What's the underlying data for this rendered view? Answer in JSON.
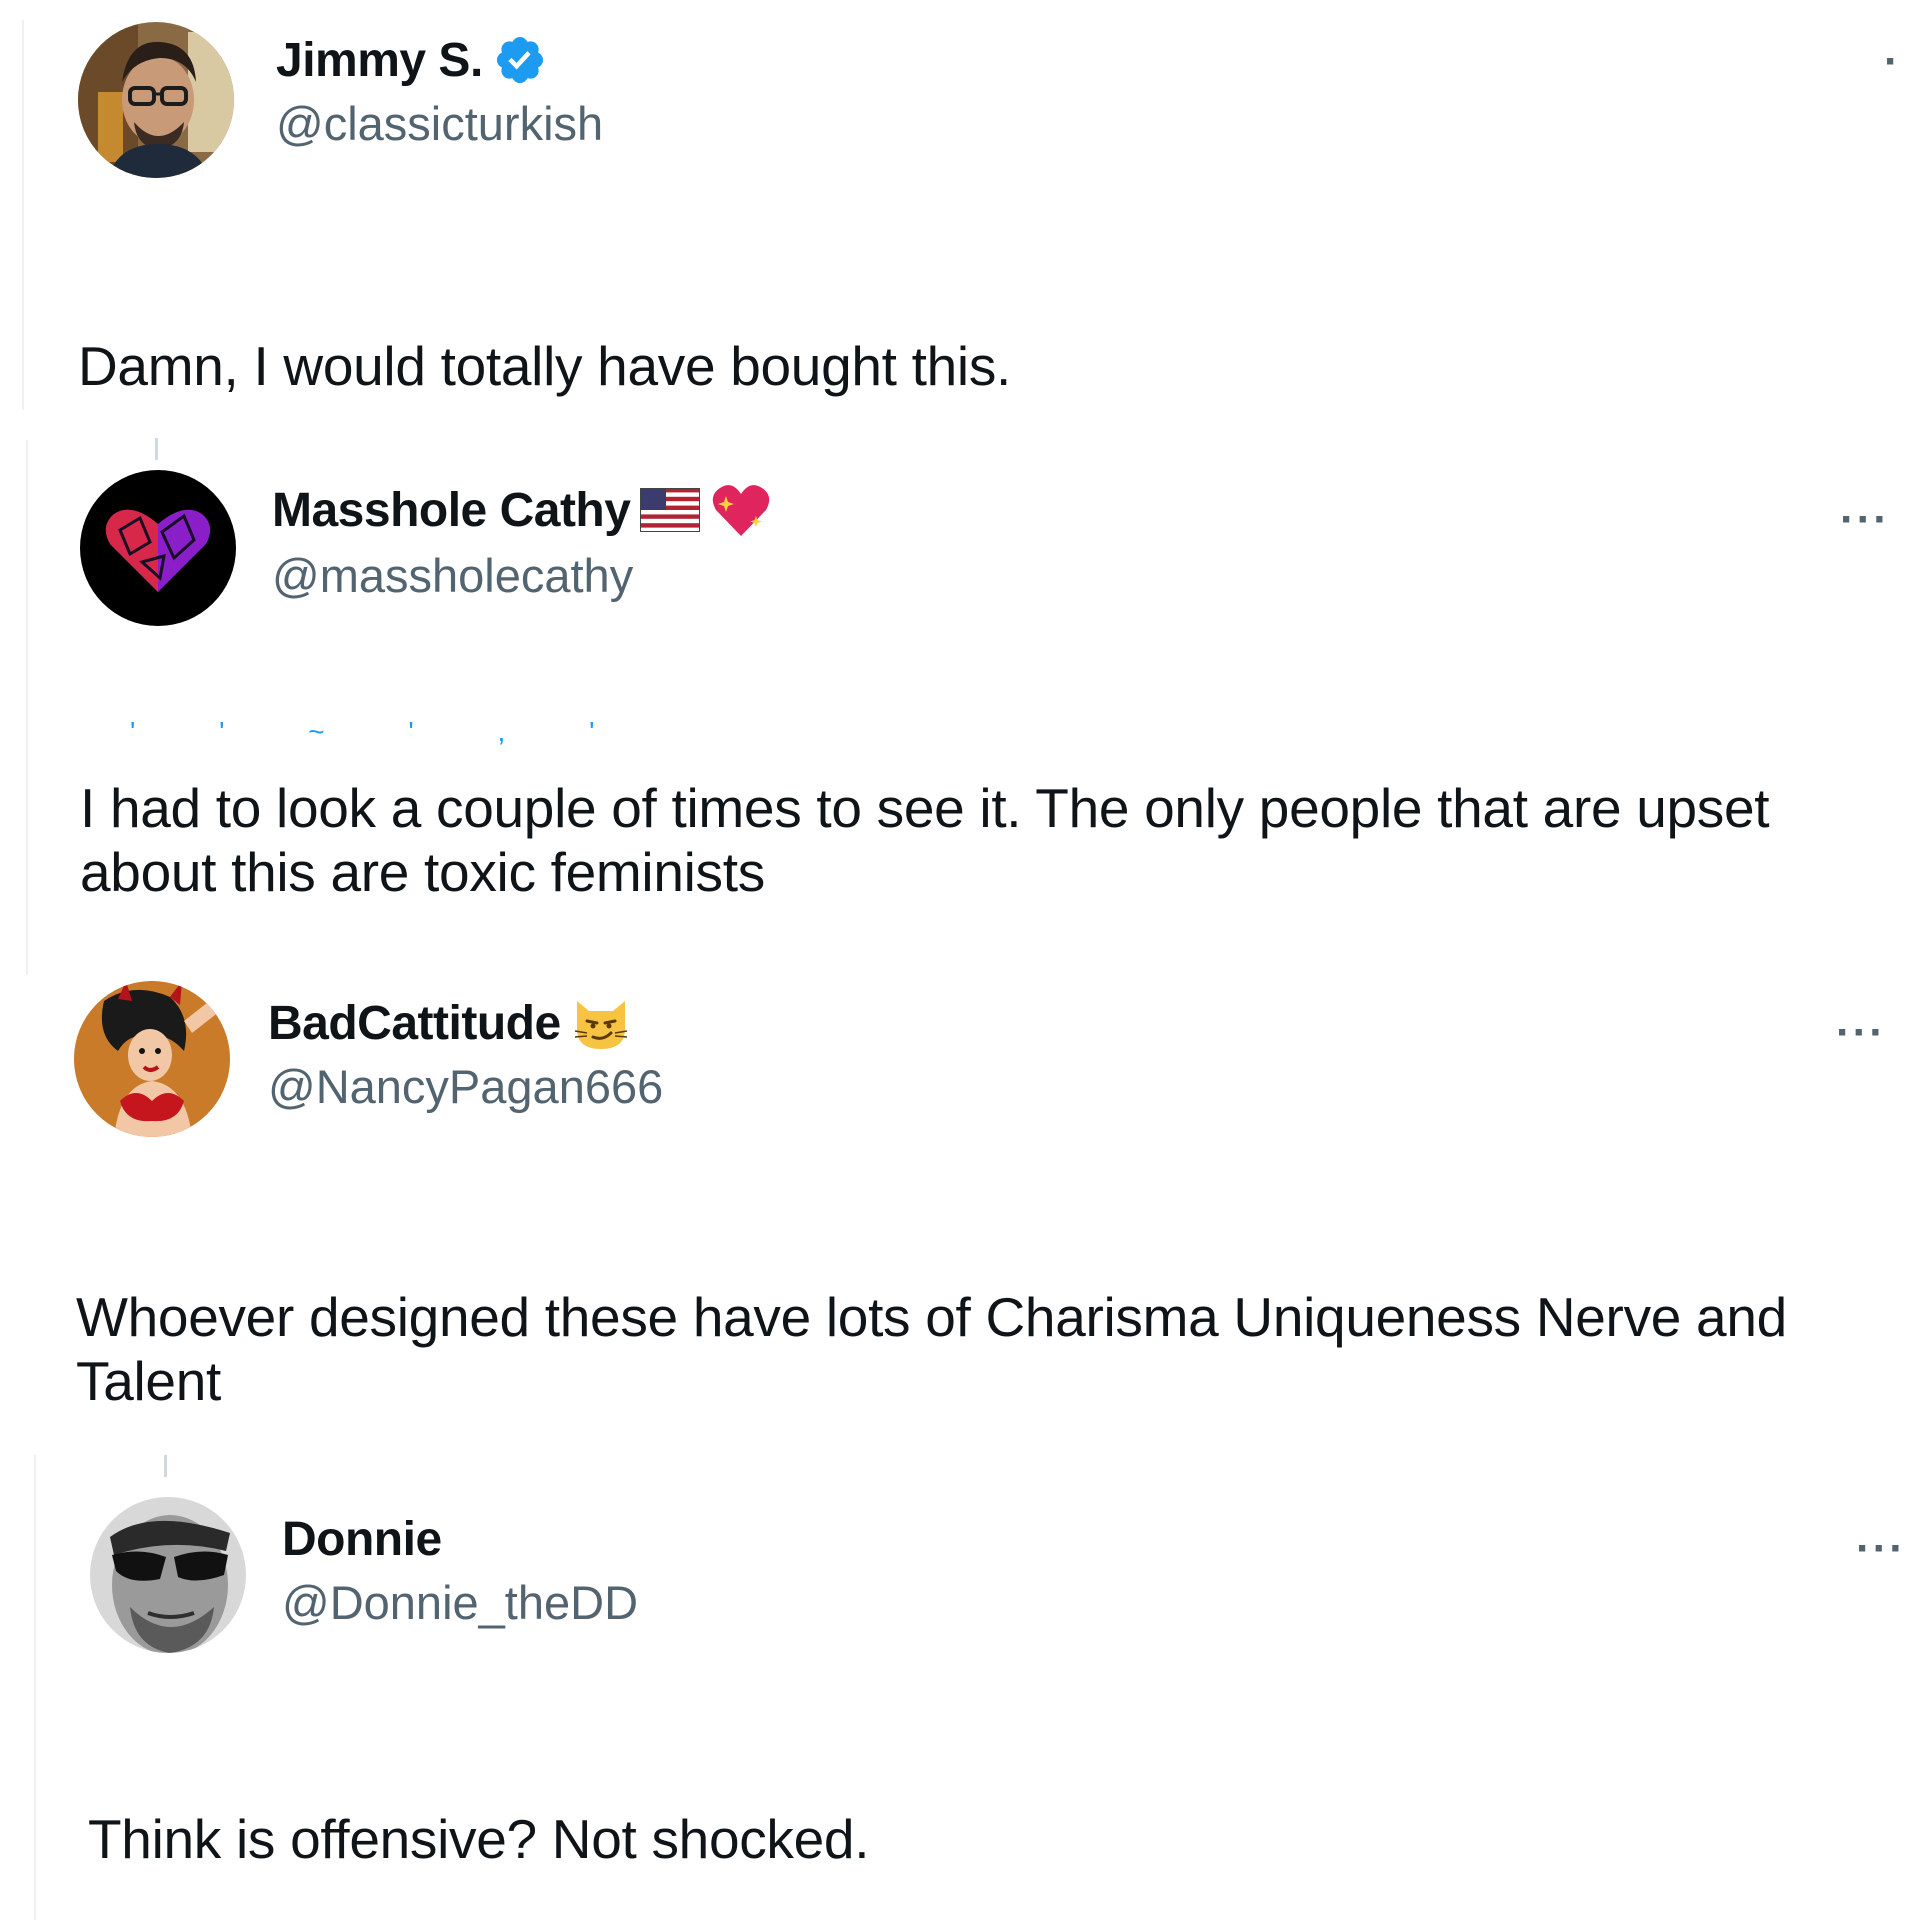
{
  "tweets": [
    {
      "display_name": "Jimmy S.",
      "handle": "@classicturkish",
      "verified": true,
      "text": "Damn, I would totally have bought this.",
      "avatar_icon": "profile-photo-man-glasses",
      "more_label": "·"
    },
    {
      "display_name": "Masshole Cathy",
      "name_emojis": [
        "us-flag-icon",
        "sparkling-heart-icon"
      ],
      "handle": "@massholecathy",
      "text": "I had to look a couple of times to see it. The only people that are upset about this are toxic feminists",
      "avatar_icon": "purple-heart-avatar",
      "more_label": "···"
    },
    {
      "display_name": "BadCattitude",
      "name_emojis": [
        "smirking-cat-icon"
      ],
      "handle": "@NancyPagan666",
      "text": "Whoever designed these have lots of Charisma Uniqueness Nerve and Talent",
      "avatar_icon": "pinup-devil-avatar",
      "more_label": "···"
    },
    {
      "display_name": "Donnie",
      "handle": "@Donnie_theDD",
      "text": "Think is offensive? Not shocked.",
      "avatar_icon": "man-sunglasses-avatar",
      "more_label": "···"
    }
  ],
  "colors": {
    "text": "#0f1419",
    "secondary": "#536471",
    "verified_blue": "#1d9bf0",
    "thread_line": "#cfd9de"
  }
}
